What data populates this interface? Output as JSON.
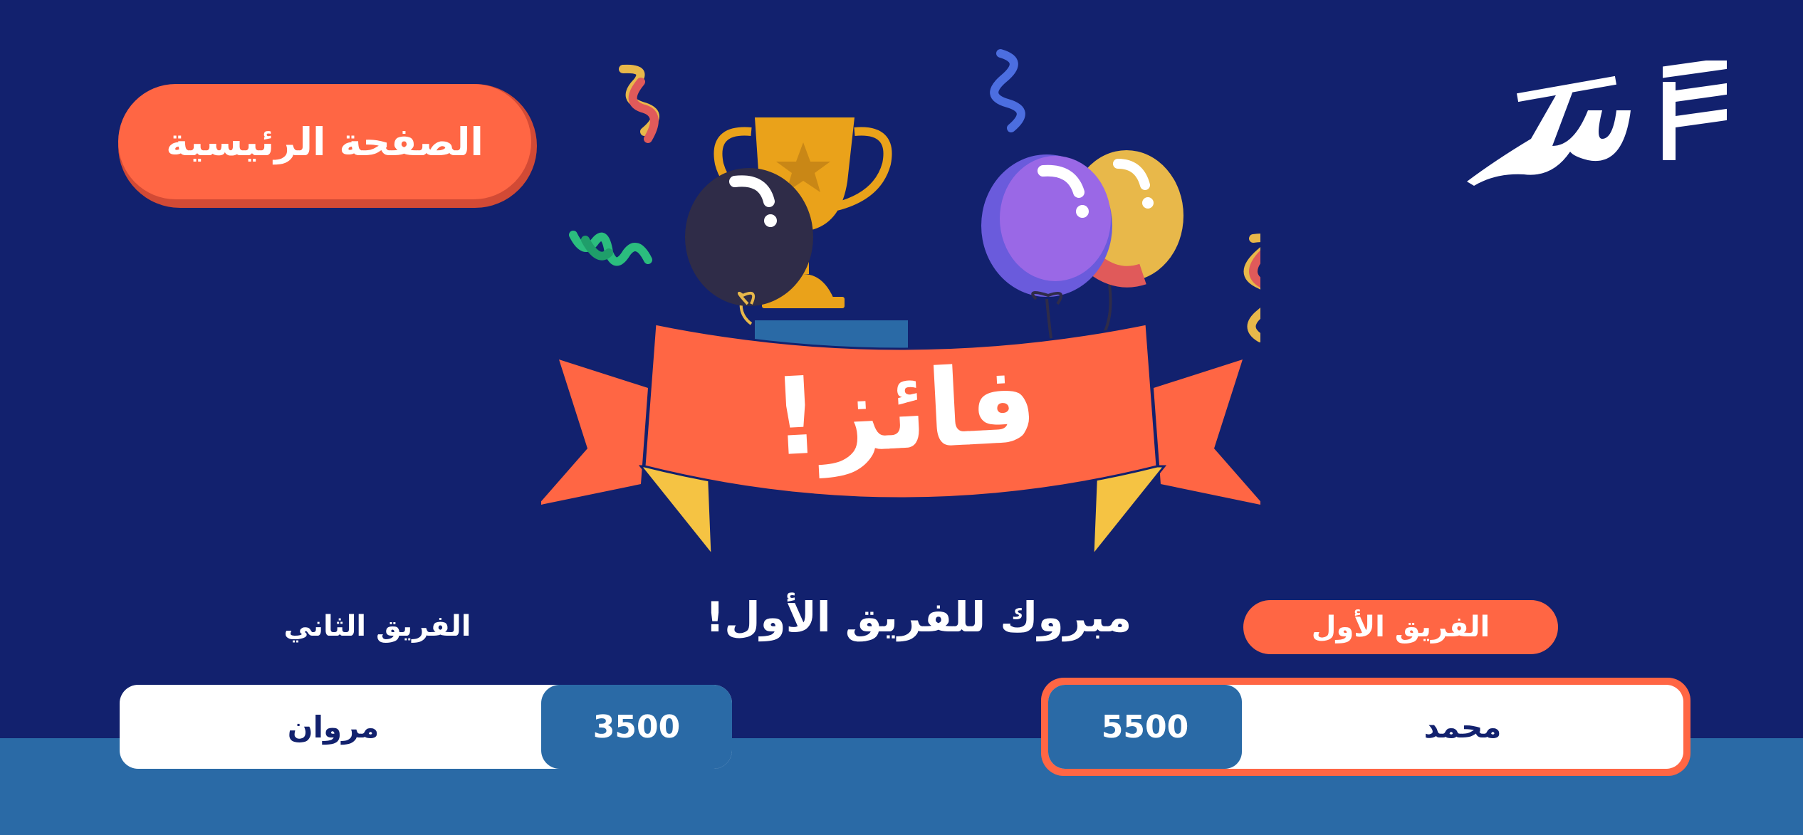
{
  "colors": {
    "background": "#12216e",
    "bottom_strip": "#2a6aa6",
    "accent": "#ff6644",
    "accent_shadow": "#d24a35",
    "score_box": "#2a6aa6",
    "card_white": "#ffffff",
    "dark_text": "#12216e",
    "gold": "#eaa21a",
    "yellow": "#f5c343"
  },
  "header": {
    "home_button_label": "الصفحة الرئيسية",
    "logo_icon": "seen-jeem-logo-icon"
  },
  "celebration": {
    "banner_text": "فائز!",
    "icons": [
      "trophy-icon",
      "balloon-black-icon",
      "balloon-purple-icon",
      "balloon-yellow-icon",
      "confetti-icon",
      "ribbon-banner-icon"
    ]
  },
  "result": {
    "congrats_text": "مبروك للفريق الأول!"
  },
  "teams": {
    "team1": {
      "label": "الفريق الأول",
      "player": "محمد",
      "score": "5500",
      "winner": true
    },
    "team2": {
      "label": "الفريق الثاني",
      "player": "مروان",
      "score": "3500",
      "winner": false
    }
  }
}
